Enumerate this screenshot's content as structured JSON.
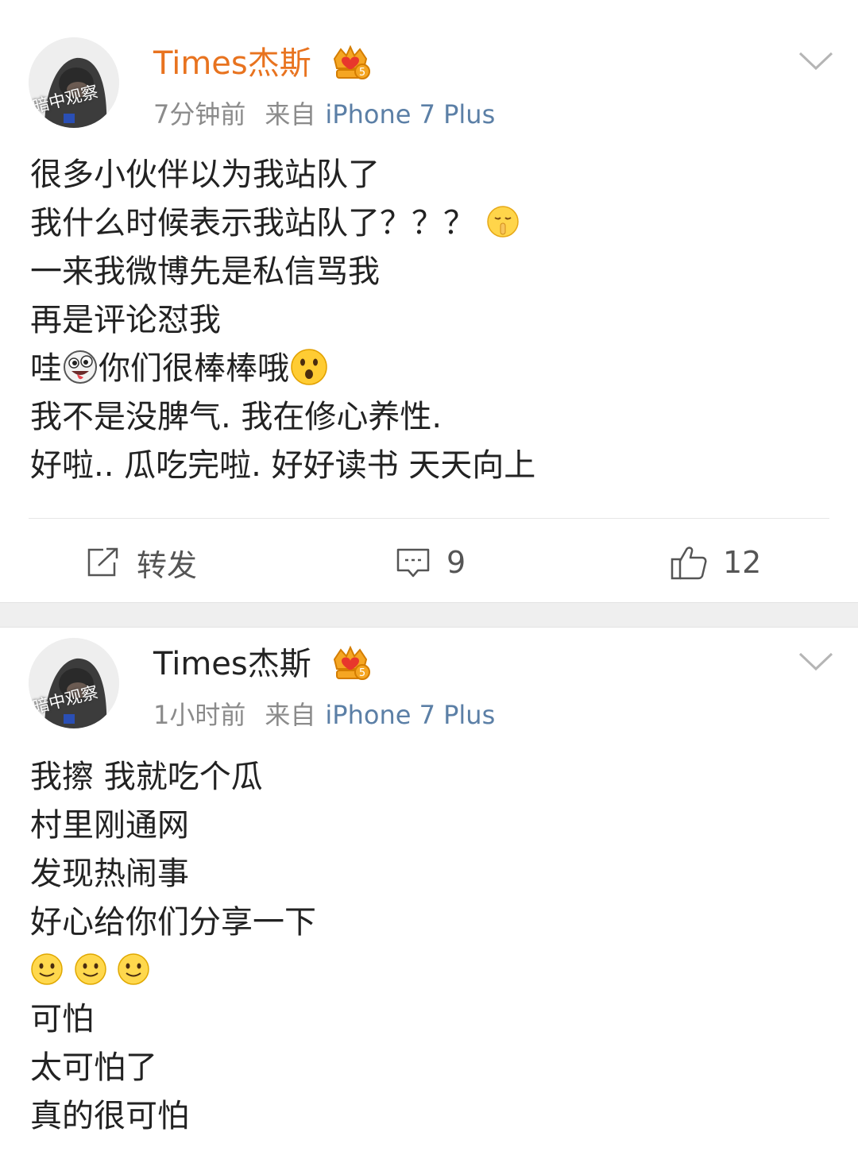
{
  "posts": [
    {
      "username": "Times杰斯",
      "username_color": "#e8731f",
      "avatar_text": "暗中观察",
      "time": "7分钟前",
      "source_prefix": "来自",
      "source": "iPhone 7 Plus",
      "lines": [
        "很多小伙伴以为我站队了",
        "我什么时候表示我站队了？？？",
        "一来我微博先是私信骂我",
        "再是评论怼我",
        "哇",
        "你们很棒棒哦",
        "我不是没脾气.  我在修心养性.",
        "好啦.. 瓜吃完啦. 好好读书 天天向上"
      ],
      "actions": {
        "repost_label": "转发",
        "comment_count": "9",
        "like_count": "12"
      }
    },
    {
      "username": "Times杰斯",
      "username_color": "#222222",
      "avatar_text": "暗中观察",
      "time": "1小时前",
      "source_prefix": "来自",
      "source": "iPhone 7 Plus",
      "lines": [
        "我擦 我就吃个瓜",
        "村里刚通网",
        "发现热闹事",
        "好心给你们分享一下",
        "可怕",
        "太可怕了",
        "真的很可怕"
      ]
    }
  ],
  "icons": [
    "verified-crown-badge-icon",
    "chevron-down-icon",
    "shush-emoji",
    "crazy-face-emoji",
    "surprised-face-emoji",
    "smile-emoji",
    "repost-icon",
    "comment-icon",
    "like-icon"
  ]
}
